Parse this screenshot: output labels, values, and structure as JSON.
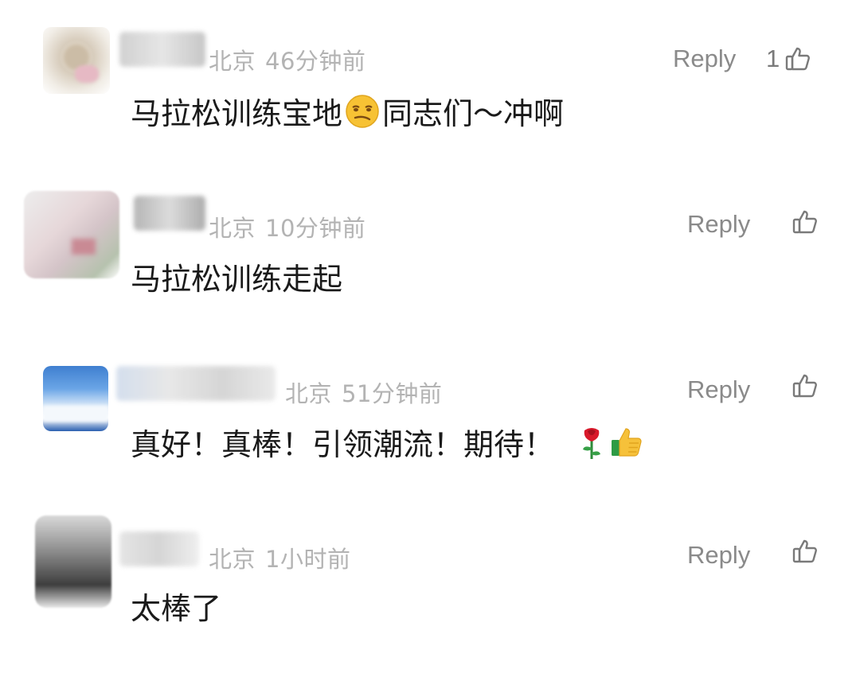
{
  "comments": [
    {
      "location": "北京",
      "time": "46分钟前",
      "reply_label": "Reply",
      "like_count": "1",
      "text_before": "马拉松训练宝地",
      "emoji": "smirk-face-emoji",
      "text_after": "同志们～冲啊"
    },
    {
      "location": "北京",
      "time": "10分钟前",
      "reply_label": "Reply",
      "like_count": "",
      "text": "马拉松训练走起"
    },
    {
      "location": "北京",
      "time": "51分钟前",
      "reply_label": "Reply",
      "like_count": "",
      "text": "真好！真棒！引领潮流！期待！",
      "emojis": [
        "rose-emoji",
        "thumbs-up-emoji"
      ]
    },
    {
      "location": "北京",
      "time": "1小时前",
      "reply_label": "Reply",
      "like_count": "",
      "text": "太棒了"
    }
  ],
  "icons": {
    "like": "thumbs-up-outline-icon"
  },
  "colors": {
    "meta_text": "#b3b3b3",
    "reply_text": "#8a8a8a",
    "body_text": "#1a1a1a"
  }
}
